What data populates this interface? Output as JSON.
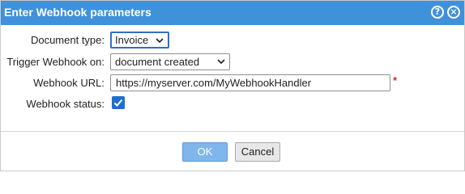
{
  "dialog": {
    "title": "Enter Webhook parameters",
    "title_bar_color": "#3f91d9",
    "icons": {
      "help": "question-circle-icon",
      "close": "close-circle-icon"
    }
  },
  "form": {
    "document_type": {
      "label": "Document type:",
      "selected": "Invoice"
    },
    "trigger": {
      "label": "Trigger Webhook on:",
      "selected": "document created"
    },
    "url": {
      "label": "Webhook URL:",
      "value": "https://myserver.com/MyWebhookHandler",
      "required_marker": "*"
    },
    "status": {
      "label": "Webhook status:",
      "checked": true
    }
  },
  "buttons": {
    "ok": "OK",
    "cancel": "Cancel"
  }
}
